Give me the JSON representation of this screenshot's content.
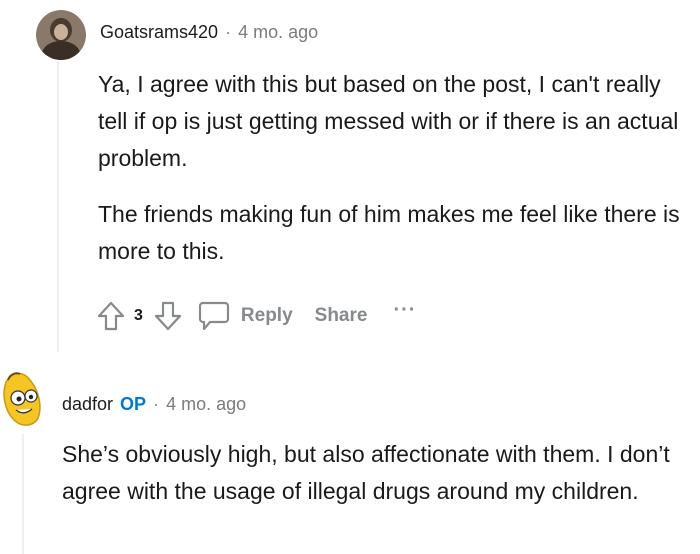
{
  "comment1": {
    "author": "Goatsrams420",
    "separator": "·",
    "time": "4 mo. ago",
    "paragraphs": [
      "Ya, I agree with this but based on the post, I can't really tell if op is just getting messed with or if there is an actual problem.",
      "The friends making fun of him makes me feel like there is more to this."
    ],
    "score": "3",
    "reply_label": "Reply",
    "share_label": "Share",
    "more_label": "···"
  },
  "comment2": {
    "author": "dadfor",
    "op_badge": "OP",
    "separator": "·",
    "time": "4 mo. ago",
    "text": "She’s obviously high, but also affectionate with them. I don’t agree with the usage of illegal drugs around my children."
  },
  "colors": {
    "icon_gray": "#878a8c",
    "op_blue": "#0079d3",
    "thread_line": "#edeff1"
  }
}
